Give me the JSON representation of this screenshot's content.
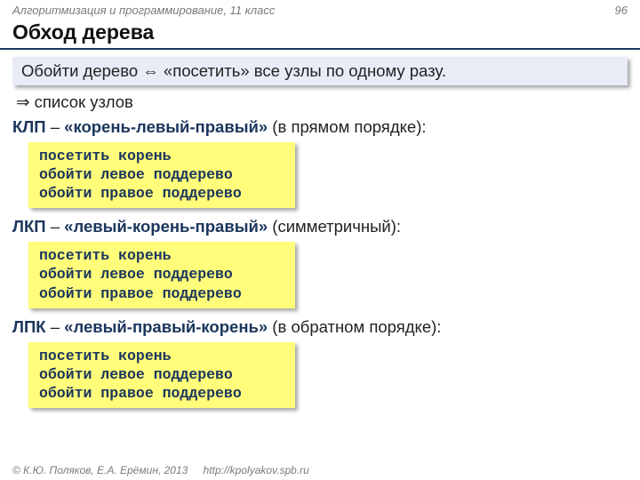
{
  "header": {
    "course": "Алгоритмизация и программирование, 11 класс",
    "page": "96"
  },
  "title": "Обход дерева",
  "highlight": "Обойти дерево ⇔ «посетить» все узлы по одному разу.",
  "arrow_line": "⇒ список узлов",
  "sections": [
    {
      "abbr": "КЛП",
      "dash": " – ",
      "desc": "«корень-левый-правый»",
      "note": " (в прямом порядке):",
      "code": [
        "посетить корень",
        "обойти левое поддерево",
        "обойти правое поддерево"
      ]
    },
    {
      "abbr": "ЛКП",
      "dash": " – ",
      "desc": "«левый-корень-правый»",
      "note": " (симметричный):",
      "code": [
        "посетить корень",
        "обойти левое поддерево",
        "обойти правое поддерево"
      ]
    },
    {
      "abbr": "ЛПК",
      "dash": " – ",
      "desc": "«левый-правый-корень»",
      "note": " (в обратном порядке):",
      "code": [
        "посетить корень",
        "обойти левое поддерево",
        "обойти правое поддерево"
      ]
    }
  ],
  "footer": {
    "copyright": "© К.Ю. Поляков, Е.А. Ерёмин, 2013",
    "url": "http://kpolyakov.spb.ru"
  }
}
